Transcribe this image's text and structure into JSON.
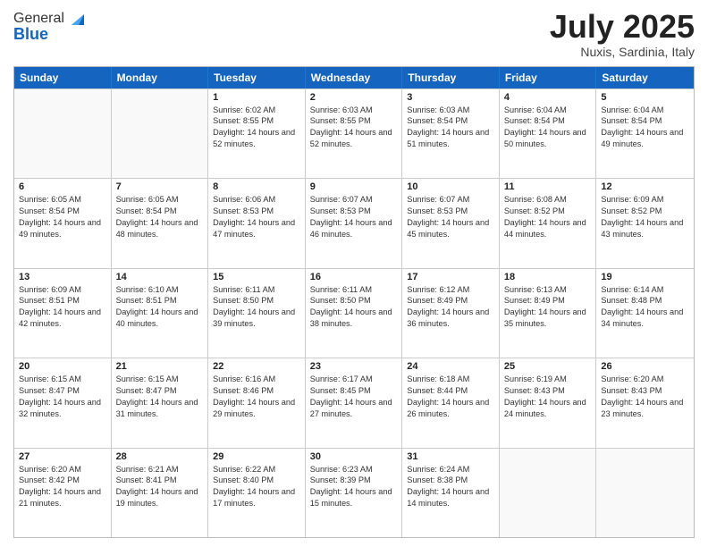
{
  "logo": {
    "general": "General",
    "blue": "Blue"
  },
  "header": {
    "month": "July 2025",
    "location": "Nuxis, Sardinia, Italy"
  },
  "weekdays": [
    "Sunday",
    "Monday",
    "Tuesday",
    "Wednesday",
    "Thursday",
    "Friday",
    "Saturday"
  ],
  "weeks": [
    [
      {
        "day": "",
        "sunrise": "",
        "sunset": "",
        "daylight": "",
        "empty": true
      },
      {
        "day": "",
        "sunrise": "",
        "sunset": "",
        "daylight": "",
        "empty": true
      },
      {
        "day": "1",
        "sunrise": "Sunrise: 6:02 AM",
        "sunset": "Sunset: 8:55 PM",
        "daylight": "Daylight: 14 hours and 52 minutes.",
        "empty": false
      },
      {
        "day": "2",
        "sunrise": "Sunrise: 6:03 AM",
        "sunset": "Sunset: 8:55 PM",
        "daylight": "Daylight: 14 hours and 52 minutes.",
        "empty": false
      },
      {
        "day": "3",
        "sunrise": "Sunrise: 6:03 AM",
        "sunset": "Sunset: 8:54 PM",
        "daylight": "Daylight: 14 hours and 51 minutes.",
        "empty": false
      },
      {
        "day": "4",
        "sunrise": "Sunrise: 6:04 AM",
        "sunset": "Sunset: 8:54 PM",
        "daylight": "Daylight: 14 hours and 50 minutes.",
        "empty": false
      },
      {
        "day": "5",
        "sunrise": "Sunrise: 6:04 AM",
        "sunset": "Sunset: 8:54 PM",
        "daylight": "Daylight: 14 hours and 49 minutes.",
        "empty": false
      }
    ],
    [
      {
        "day": "6",
        "sunrise": "Sunrise: 6:05 AM",
        "sunset": "Sunset: 8:54 PM",
        "daylight": "Daylight: 14 hours and 49 minutes.",
        "empty": false
      },
      {
        "day": "7",
        "sunrise": "Sunrise: 6:05 AM",
        "sunset": "Sunset: 8:54 PM",
        "daylight": "Daylight: 14 hours and 48 minutes.",
        "empty": false
      },
      {
        "day": "8",
        "sunrise": "Sunrise: 6:06 AM",
        "sunset": "Sunset: 8:53 PM",
        "daylight": "Daylight: 14 hours and 47 minutes.",
        "empty": false
      },
      {
        "day": "9",
        "sunrise": "Sunrise: 6:07 AM",
        "sunset": "Sunset: 8:53 PM",
        "daylight": "Daylight: 14 hours and 46 minutes.",
        "empty": false
      },
      {
        "day": "10",
        "sunrise": "Sunrise: 6:07 AM",
        "sunset": "Sunset: 8:53 PM",
        "daylight": "Daylight: 14 hours and 45 minutes.",
        "empty": false
      },
      {
        "day": "11",
        "sunrise": "Sunrise: 6:08 AM",
        "sunset": "Sunset: 8:52 PM",
        "daylight": "Daylight: 14 hours and 44 minutes.",
        "empty": false
      },
      {
        "day": "12",
        "sunrise": "Sunrise: 6:09 AM",
        "sunset": "Sunset: 8:52 PM",
        "daylight": "Daylight: 14 hours and 43 minutes.",
        "empty": false
      }
    ],
    [
      {
        "day": "13",
        "sunrise": "Sunrise: 6:09 AM",
        "sunset": "Sunset: 8:51 PM",
        "daylight": "Daylight: 14 hours and 42 minutes.",
        "empty": false
      },
      {
        "day": "14",
        "sunrise": "Sunrise: 6:10 AM",
        "sunset": "Sunset: 8:51 PM",
        "daylight": "Daylight: 14 hours and 40 minutes.",
        "empty": false
      },
      {
        "day": "15",
        "sunrise": "Sunrise: 6:11 AM",
        "sunset": "Sunset: 8:50 PM",
        "daylight": "Daylight: 14 hours and 39 minutes.",
        "empty": false
      },
      {
        "day": "16",
        "sunrise": "Sunrise: 6:11 AM",
        "sunset": "Sunset: 8:50 PM",
        "daylight": "Daylight: 14 hours and 38 minutes.",
        "empty": false
      },
      {
        "day": "17",
        "sunrise": "Sunrise: 6:12 AM",
        "sunset": "Sunset: 8:49 PM",
        "daylight": "Daylight: 14 hours and 36 minutes.",
        "empty": false
      },
      {
        "day": "18",
        "sunrise": "Sunrise: 6:13 AM",
        "sunset": "Sunset: 8:49 PM",
        "daylight": "Daylight: 14 hours and 35 minutes.",
        "empty": false
      },
      {
        "day": "19",
        "sunrise": "Sunrise: 6:14 AM",
        "sunset": "Sunset: 8:48 PM",
        "daylight": "Daylight: 14 hours and 34 minutes.",
        "empty": false
      }
    ],
    [
      {
        "day": "20",
        "sunrise": "Sunrise: 6:15 AM",
        "sunset": "Sunset: 8:47 PM",
        "daylight": "Daylight: 14 hours and 32 minutes.",
        "empty": false
      },
      {
        "day": "21",
        "sunrise": "Sunrise: 6:15 AM",
        "sunset": "Sunset: 8:47 PM",
        "daylight": "Daylight: 14 hours and 31 minutes.",
        "empty": false
      },
      {
        "day": "22",
        "sunrise": "Sunrise: 6:16 AM",
        "sunset": "Sunset: 8:46 PM",
        "daylight": "Daylight: 14 hours and 29 minutes.",
        "empty": false
      },
      {
        "day": "23",
        "sunrise": "Sunrise: 6:17 AM",
        "sunset": "Sunset: 8:45 PM",
        "daylight": "Daylight: 14 hours and 27 minutes.",
        "empty": false
      },
      {
        "day": "24",
        "sunrise": "Sunrise: 6:18 AM",
        "sunset": "Sunset: 8:44 PM",
        "daylight": "Daylight: 14 hours and 26 minutes.",
        "empty": false
      },
      {
        "day": "25",
        "sunrise": "Sunrise: 6:19 AM",
        "sunset": "Sunset: 8:43 PM",
        "daylight": "Daylight: 14 hours and 24 minutes.",
        "empty": false
      },
      {
        "day": "26",
        "sunrise": "Sunrise: 6:20 AM",
        "sunset": "Sunset: 8:43 PM",
        "daylight": "Daylight: 14 hours and 23 minutes.",
        "empty": false
      }
    ],
    [
      {
        "day": "27",
        "sunrise": "Sunrise: 6:20 AM",
        "sunset": "Sunset: 8:42 PM",
        "daylight": "Daylight: 14 hours and 21 minutes.",
        "empty": false
      },
      {
        "day": "28",
        "sunrise": "Sunrise: 6:21 AM",
        "sunset": "Sunset: 8:41 PM",
        "daylight": "Daylight: 14 hours and 19 minutes.",
        "empty": false
      },
      {
        "day": "29",
        "sunrise": "Sunrise: 6:22 AM",
        "sunset": "Sunset: 8:40 PM",
        "daylight": "Daylight: 14 hours and 17 minutes.",
        "empty": false
      },
      {
        "day": "30",
        "sunrise": "Sunrise: 6:23 AM",
        "sunset": "Sunset: 8:39 PM",
        "daylight": "Daylight: 14 hours and 15 minutes.",
        "empty": false
      },
      {
        "day": "31",
        "sunrise": "Sunrise: 6:24 AM",
        "sunset": "Sunset: 8:38 PM",
        "daylight": "Daylight: 14 hours and 14 minutes.",
        "empty": false
      },
      {
        "day": "",
        "sunrise": "",
        "sunset": "",
        "daylight": "",
        "empty": true
      },
      {
        "day": "",
        "sunrise": "",
        "sunset": "",
        "daylight": "",
        "empty": true
      }
    ]
  ]
}
